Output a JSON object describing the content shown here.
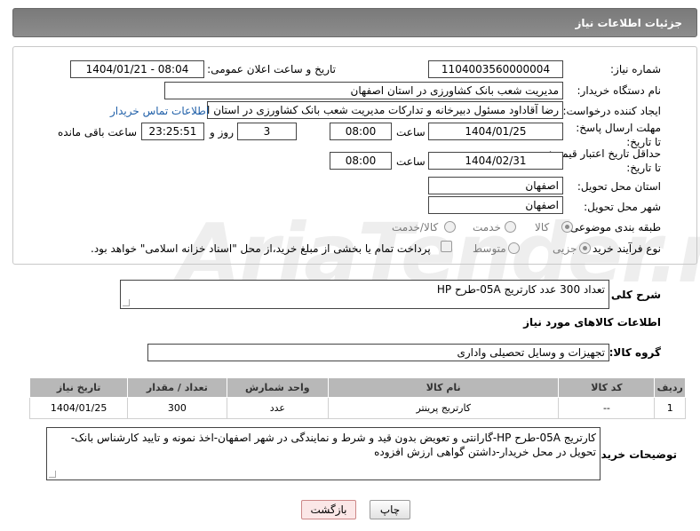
{
  "header": {
    "title": "جزئیات اطلاعات نیاز"
  },
  "form": {
    "need_number_label": "شماره نیاز:",
    "need_number": "1104003560000004",
    "announce_label": "تاریخ و ساعت اعلان عمومی:",
    "announce_value": "1404/01/21 - 08:04",
    "buyer_org_label": "نام دستگاه خریدار:",
    "buyer_org": "مدیریت شعب بانک کشاورزی در استان اصفهان",
    "creator_label": "ایجاد کننده درخواست:",
    "creator": "رضا آقاداود مسئول دبیرخانه و تدارکات مدیریت شعب بانک کشاورزی در استان اص",
    "contact_link": "اطلاعات تماس خریدار",
    "deadline_label": "مهلت ارسال پاسخ: تا تاریخ:",
    "deadline_date": "1404/01/25",
    "time_word": "ساعت",
    "deadline_time": "08:00",
    "days": "3",
    "days_word": "روز و",
    "remaining_time": "23:25:51",
    "remaining_word": "ساعت باقی مانده",
    "validity_label": "حداقل تاریخ اعتبار قیمت: تا تاریخ:",
    "validity_date": "1404/02/31",
    "validity_time": "08:00",
    "province_label": "استان محل تحویل:",
    "province": "اصفهان",
    "city_label": "شهر محل تحویل:",
    "city": "اصفهان",
    "category_label": "طبقه بندی موضوعی:",
    "category_options": [
      "کالا",
      "خدمت",
      "کالا/خدمت"
    ],
    "process_label": "نوع فرآیند خرید :",
    "process_options": [
      "جزیی",
      "متوسط"
    ],
    "payment_note": "پرداخت تمام یا بخشی از مبلغ خرید،از محل \"اسناد خزانه اسلامی\" خواهد بود."
  },
  "summary": {
    "label": "شرح کلی نیاز:",
    "text": "تعداد 300 عدد کارتریج 05A-طرح HP"
  },
  "goods": {
    "section_title": "اطلاعات کالاهای مورد نیاز",
    "group_label": "گروه کالا:",
    "group_value": "تجهیزات و وسایل تحصیلی واداری",
    "columns": [
      "ردیف",
      "کد کالا",
      "نام کالا",
      "واحد شمارش",
      "تعداد / مقدار",
      "تاریخ نیاز"
    ],
    "rows": [
      [
        "1",
        "--",
        "کارتریج پرینتر",
        "عدد",
        "300",
        "1404/01/25"
      ]
    ]
  },
  "buyer_notes": {
    "label": "توضیحات خریدار:",
    "text": "کارتریج 05A-طرح HP-گارانتی و تعویض بدون قید و شرط و نمایندگی در شهر اصفهان-اخذ نمونه و تایید کارشناس بانک-تحویل در محل خریدار-داشتن گواهی ارزش افزوده"
  },
  "buttons": {
    "print": "چاپ",
    "back": "بازگشت"
  },
  "watermark": "AriaTender.neT"
}
